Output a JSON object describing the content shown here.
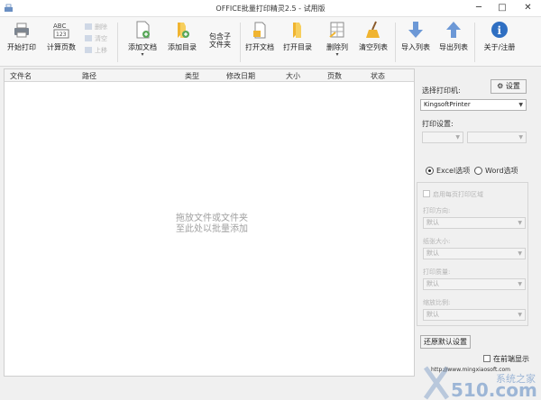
{
  "window": {
    "title": "OFFICE批量打印精灵2.5 - 试用版",
    "minimize": "─",
    "maximize": "□",
    "close": "✕"
  },
  "toolbar": {
    "start_print": "开始打印",
    "count_pages": "计算页数",
    "small_items": [
      "删除",
      "清空",
      "上移"
    ],
    "add_docs": "添加文档",
    "add_folder": "添加目录",
    "include_subfolders": "包含子\n文件夹",
    "open_doc": "打开文档",
    "open_folder": "打开目录",
    "delete_col": "删除列",
    "clear_list": "清空列表",
    "import_list": "导入列表",
    "export_list": "导出列表",
    "about": "关于/注册",
    "dropdown_glyph": "▾"
  },
  "file_list": {
    "columns": [
      "文件名",
      "路径",
      "类型",
      "修改日期",
      "大小",
      "页数",
      "状态"
    ],
    "empty_line1": "拖放文件或文件夹",
    "empty_line2": "至此处以批量添加"
  },
  "side_panel": {
    "choose_printer_label": "选择打印机:",
    "settings_button": "设置",
    "printer_value": "KingsoftPrinter",
    "print_settings_label": "打印设置:",
    "excel_option": "Excel选项",
    "word_option": "Word选项",
    "selected_option": "excel",
    "disabled_checkbox_label": "启用每页打印区域",
    "disabled_fields": [
      {
        "label": "打印方向:",
        "value": "默认"
      },
      {
        "label": "纸张大小:",
        "value": "默认"
      },
      {
        "label": "打印质量:",
        "value": "默认"
      },
      {
        "label": "缩放比例:",
        "value": "默认"
      }
    ],
    "restore_defaults": "还原默认设置",
    "always_on_top": "在前端显示"
  },
  "watermark": {
    "url": "http://www.mingxiaosoft.com",
    "brand": "510.com",
    "brand_cn": "系统之家"
  },
  "colors": {
    "accent_blue": "#3a78c8",
    "icon_yellow": "#f0b430",
    "icon_green": "#5aa85a"
  }
}
